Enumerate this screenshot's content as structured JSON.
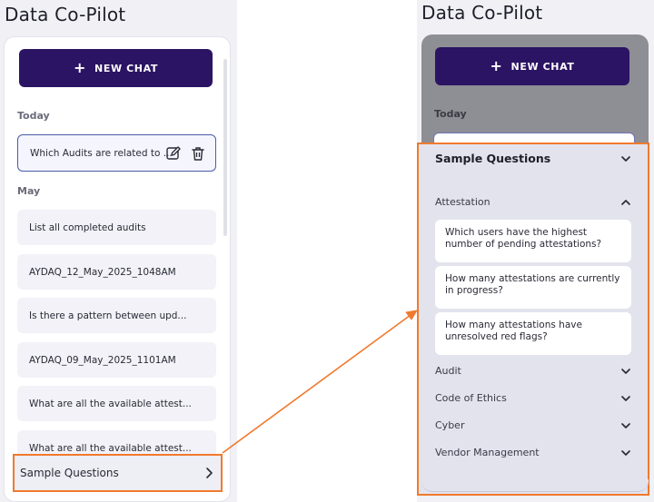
{
  "left": {
    "app_title": "Data Co-Pilot",
    "new_chat_label": "NEW CHAT",
    "sections": {
      "today": "Today",
      "may": "May"
    },
    "active_item": "Which Audits are related to ...",
    "history": [
      "List all completed audits",
      "AYDAQ_12_May_2025_1048AM",
      "Is there a pattern between upd...",
      "AYDAQ_09_May_2025_1101AM",
      "What are all the available attest...",
      "What are all the available attest..."
    ],
    "sample_questions_label": "Sample Questions"
  },
  "right": {
    "app_title": "Data Co-Pilot",
    "new_chat_label": "NEW CHAT",
    "today_label": "Today",
    "sample_questions_title": "Sample Questions",
    "categories": [
      {
        "label": "Attestation",
        "expanded": true,
        "questions": [
          "Which users have the highest number of pending attestations?",
          "How many attestations are currently in progress?",
          "How many attestations have unresolved red flags?"
        ]
      },
      {
        "label": "Audit",
        "expanded": false
      },
      {
        "label": "Code of Ethics",
        "expanded": false
      },
      {
        "label": "Cyber",
        "expanded": false
      },
      {
        "label": "Vendor Management",
        "expanded": false
      }
    ]
  },
  "colors": {
    "brand": "#2b1463",
    "highlight": "#f07a2e",
    "active_border": "#4a5ca8"
  }
}
